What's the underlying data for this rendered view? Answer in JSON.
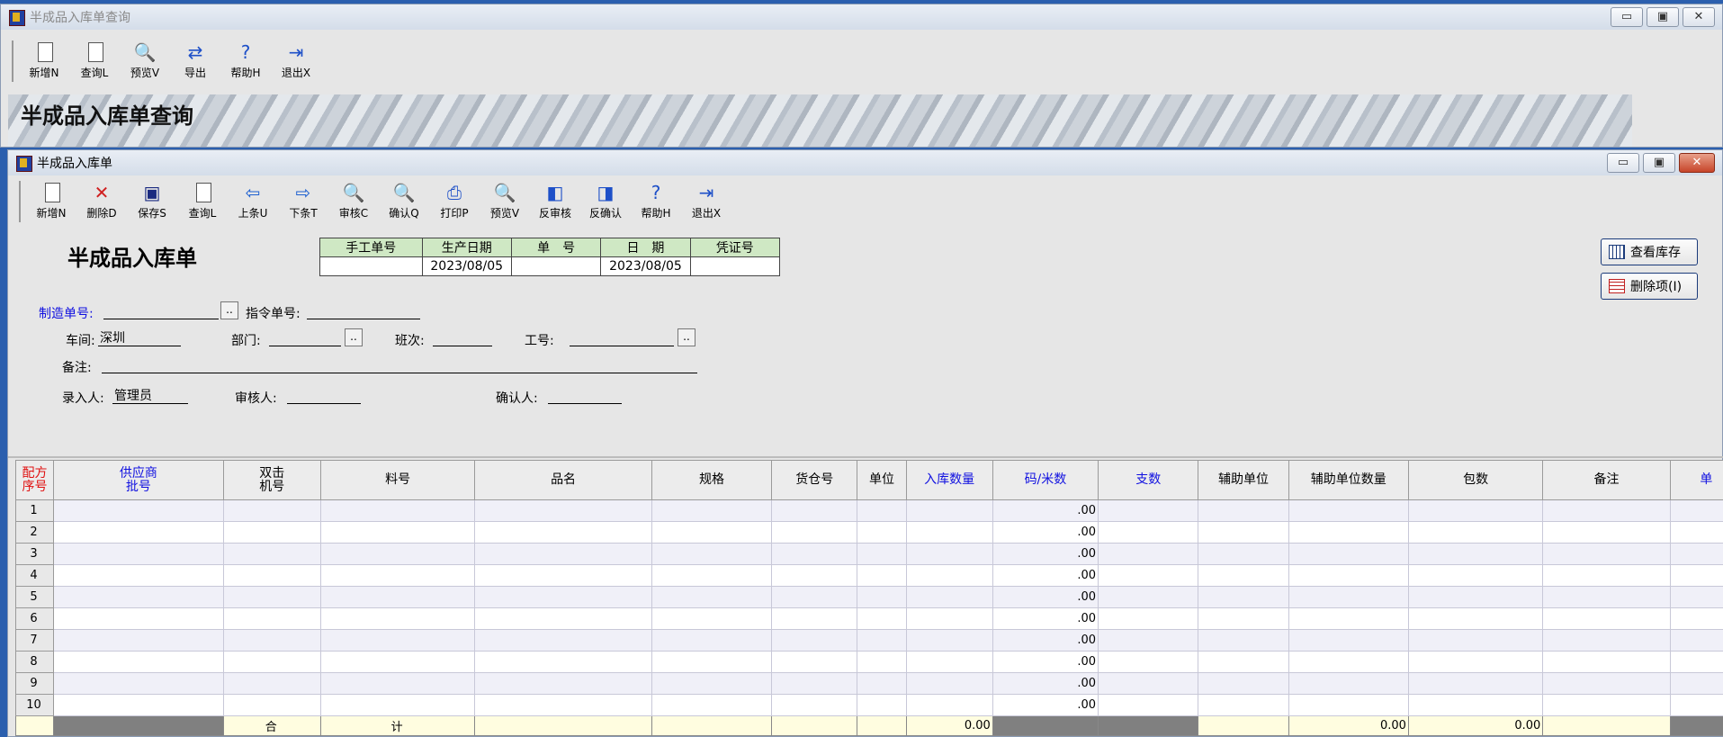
{
  "back_window": {
    "title": "半成品入库单查询",
    "toolbar": [
      {
        "label": "新增N",
        "icon": "new-doc-icon"
      },
      {
        "label": "查询L",
        "icon": "query-icon"
      },
      {
        "label": "预览V",
        "icon": "preview-icon"
      },
      {
        "label": "导出",
        "icon": "export-icon"
      },
      {
        "label": "帮助H",
        "icon": "help-icon"
      },
      {
        "label": "退出X",
        "icon": "exit-icon"
      }
    ],
    "banner_title": "半成品入库单查询"
  },
  "front_window": {
    "title": "半成品入库单",
    "toolbar": [
      {
        "label": "新增N",
        "icon": "new-doc-icon"
      },
      {
        "label": "删除D",
        "icon": "delete-icon"
      },
      {
        "label": "保存S",
        "icon": "save-icon"
      },
      {
        "label": "查询L",
        "icon": "query-icon"
      },
      {
        "label": "上条U",
        "icon": "prev-arrow-icon"
      },
      {
        "label": "下条T",
        "icon": "next-arrow-icon"
      },
      {
        "label": "审核C",
        "icon": "audit-icon"
      },
      {
        "label": "确认Q",
        "icon": "confirm-icon"
      },
      {
        "label": "打印P",
        "icon": "print-icon"
      },
      {
        "label": "预览V",
        "icon": "preview-icon"
      },
      {
        "label": "反审核",
        "icon": "unaudit-icon"
      },
      {
        "label": "反确认",
        "icon": "unconfirm-icon"
      },
      {
        "label": "帮助H",
        "icon": "help-icon"
      },
      {
        "label": "退出X",
        "icon": "exit-icon"
      }
    ],
    "form_title": "半成品入库单",
    "header_table": {
      "headers": [
        "手工单号",
        "生产日期",
        "单　号",
        "日　期",
        "凭证号"
      ],
      "values": [
        "",
        "2023/08/05",
        "",
        "2023/08/05",
        ""
      ]
    },
    "fields": {
      "mfg_order_label": "制造单号:",
      "mfg_order_value": "",
      "instruction_label": "指令单号:",
      "instruction_value": "",
      "workshop_label": "车间:",
      "workshop_value": "深圳",
      "dept_label": "部门:",
      "dept_value": "",
      "shift_label": "班次:",
      "shift_value": "",
      "worker_label": "工号:",
      "worker_value": "",
      "remark_label": "备注:",
      "remark_value": "",
      "entered_by_label": "录入人:",
      "entered_by_value": "管理员",
      "auditor_label": "审核人:",
      "auditor_value": "",
      "confirmer_label": "确认人:",
      "confirmer_value": ""
    },
    "side_buttons": {
      "view_stock": "查看库存",
      "delete_item": "删除项(I)"
    },
    "grid": {
      "columns": [
        {
          "label": "配方\n序号",
          "color": "red"
        },
        {
          "label": "供应商\n批号",
          "color": "blue"
        },
        {
          "label": "双击\n机号",
          "color": "black"
        },
        {
          "label": "料号",
          "color": "black"
        },
        {
          "label": "品名",
          "color": "black"
        },
        {
          "label": "规格",
          "color": "black"
        },
        {
          "label": "货仓号",
          "color": "black"
        },
        {
          "label": "单位",
          "color": "black"
        },
        {
          "label": "入库数量",
          "color": "blue"
        },
        {
          "label": "码/米数",
          "color": "blue"
        },
        {
          "label": "支数",
          "color": "blue"
        },
        {
          "label": "辅助单位",
          "color": "black"
        },
        {
          "label": "辅助单位数量",
          "color": "black"
        },
        {
          "label": "包数",
          "color": "black"
        },
        {
          "label": "备注",
          "color": "black"
        },
        {
          "label": "单",
          "color": "blue"
        }
      ],
      "rows": [
        "1",
        "2",
        "3",
        "4",
        "5",
        "6",
        "7",
        "8",
        "9",
        "10"
      ],
      "row_meter_value": ".00",
      "total": {
        "label_a": "合",
        "label_b": "计",
        "qty": "0.00",
        "aux_qty": "0.00",
        "packs": "0.00"
      }
    }
  },
  "colors": {
    "accent_blue": "#1010e0",
    "accent_red": "#e01010",
    "header_green": "#cfe8c4"
  }
}
